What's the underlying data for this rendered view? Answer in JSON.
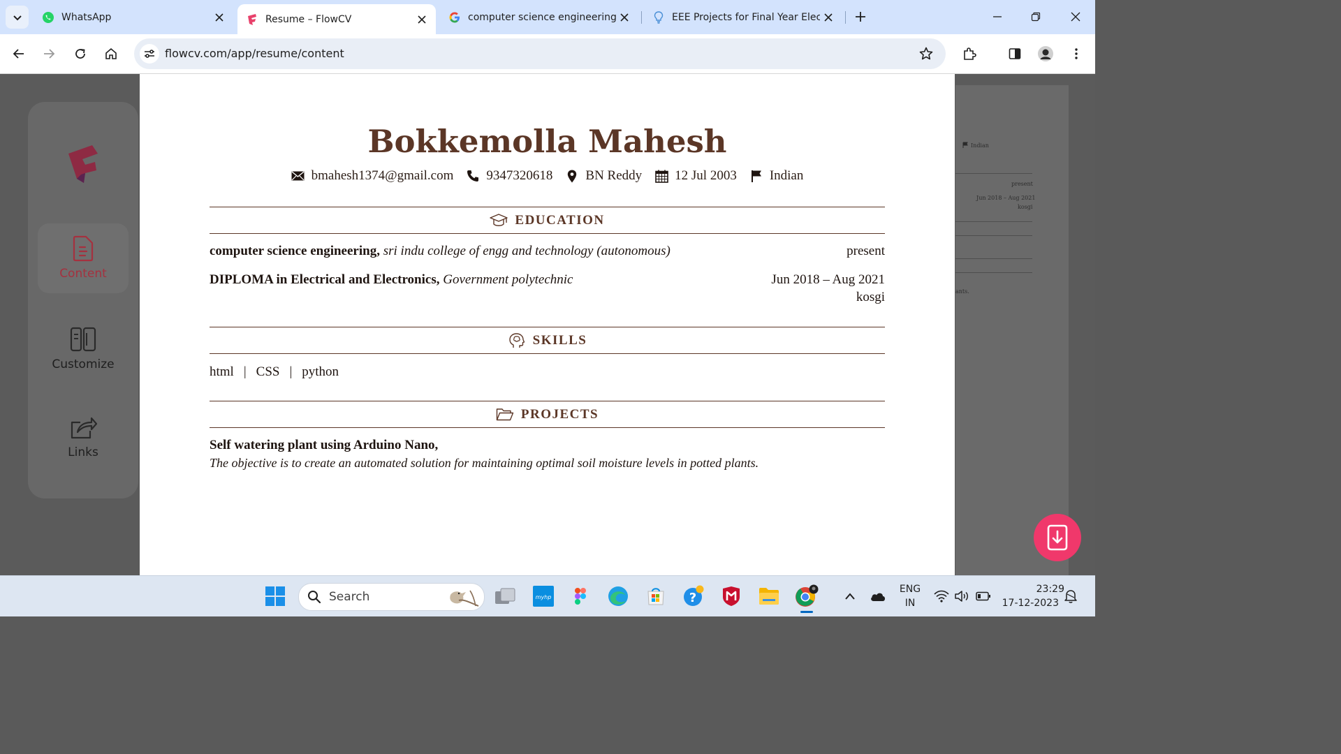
{
  "browser": {
    "tabs": [
      {
        "title": "WhatsApp",
        "icon": "whatsapp-icon",
        "active": false
      },
      {
        "title": "Resume – FlowCV",
        "icon": "flowcv-icon",
        "active": true
      },
      {
        "title": "computer science engineering -",
        "icon": "google-icon",
        "active": false
      },
      {
        "title": "EEE Projects for Final Year Electr",
        "icon": "lightbulb-icon",
        "active": false
      }
    ],
    "url": "flowcv.com/app/resume/content"
  },
  "sidebar": {
    "items": [
      {
        "label": "Content",
        "icon": "document-icon",
        "active": true
      },
      {
        "label": "Customize",
        "icon": "columns-icon",
        "active": false
      },
      {
        "label": "Links",
        "icon": "share-icon",
        "active": false
      }
    ]
  },
  "resume": {
    "name": "Bokkemolla Mahesh",
    "contacts": {
      "email": "bmahesh1374@gmail.com",
      "phone": "9347320618",
      "location": "BN Reddy",
      "birthdate": "12 Jul 2003",
      "nationality": "Indian"
    },
    "education": {
      "heading": "EDUCATION",
      "entries": [
        {
          "degree": "computer science engineering,",
          "school": "sri indu college of engg and technology (autonomous)",
          "date": "present",
          "location": ""
        },
        {
          "degree": "DIPLOMA in Electrical and Electronics,",
          "school": "Government polytechnic",
          "date": "Jun 2018 – Aug 2021",
          "location": "kosgi"
        }
      ]
    },
    "skills": {
      "heading": "SKILLS",
      "items": [
        "html",
        "CSS",
        "python"
      ],
      "separator": "|"
    },
    "projects": {
      "heading": "PROJECTS",
      "title": "Self watering plant using Arduino Nano,",
      "description": "The objective is to create an automated solution for maintaining optimal soil moisture levels in potted plants."
    }
  },
  "preview_peek": {
    "nationality": "Indian",
    "present": "present",
    "dates": "Jun 2018 – Aug 2021",
    "location": "kosgi",
    "fragment": "ants."
  },
  "taskbar": {
    "search_placeholder": "Search",
    "language": "ENG",
    "region": "IN",
    "time": "23:29",
    "date": "17-12-2023"
  },
  "colors": {
    "accent": "#5b3626",
    "fab": "#f0386b",
    "tabstrip": "#d3e3fd"
  }
}
